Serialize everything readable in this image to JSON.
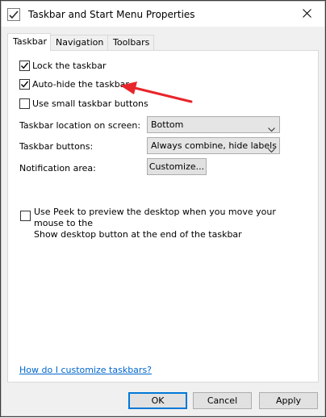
{
  "window": {
    "title": "Taskbar and Start Menu Properties"
  },
  "icons": {
    "app": "taskbar-properties-icon",
    "close": "close-icon",
    "checkmark": "checkmark-icon",
    "chevron": "chevron-down-icon"
  },
  "tabs": [
    {
      "label": "Taskbar",
      "active": true
    },
    {
      "label": "Navigation",
      "active": false
    },
    {
      "label": "Toolbars",
      "active": false
    }
  ],
  "options": {
    "lock_taskbar": {
      "label": "Lock the taskbar",
      "checked": true
    },
    "auto_hide": {
      "label": "Auto-hide the taskbar",
      "checked": true
    },
    "small_buttons": {
      "label": "Use small taskbar buttons",
      "checked": false
    }
  },
  "settings": {
    "location": {
      "label": "Taskbar location on screen:",
      "value": "Bottom"
    },
    "buttons": {
      "label": "Taskbar buttons:",
      "value": "Always combine, hide labels"
    },
    "notification": {
      "label": "Notification area:",
      "button": "Customize..."
    }
  },
  "peek": {
    "line1": "Use Peek to preview the desktop when you move your mouse to the",
    "line2": "Show desktop button at the end of the taskbar",
    "checked": false
  },
  "help_link": "How do I customize taskbars?",
  "footer": {
    "ok": "OK",
    "cancel": "Cancel",
    "apply": "Apply"
  },
  "colors": {
    "annotation_arrow": "#e8252b",
    "link": "#0066cc",
    "default_button_border": "#0078d7"
  }
}
